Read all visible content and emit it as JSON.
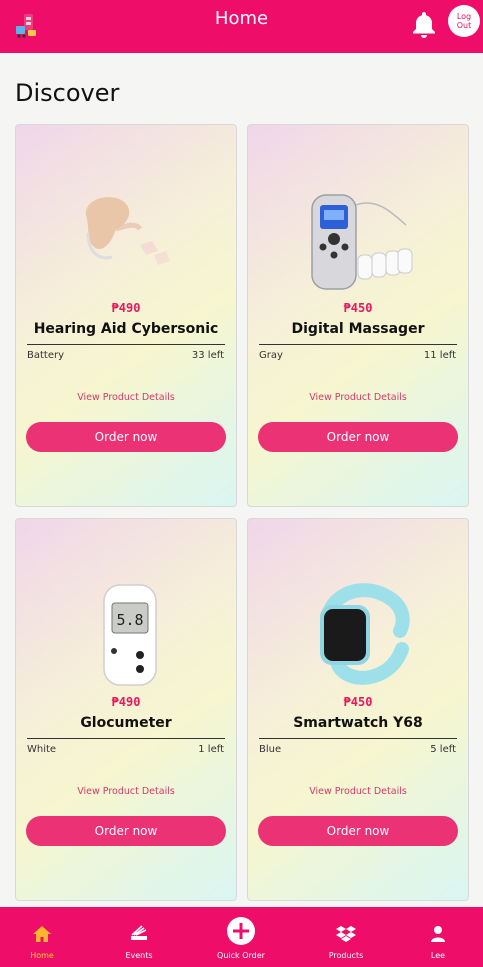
{
  "header": {
    "title": "Home",
    "logout_label": "Log Out"
  },
  "main": {
    "heading": "Discover",
    "currency_symbol": "₱"
  },
  "products": [
    {
      "price": "₱490",
      "name": "Hearing Aid Cybersonic",
      "variant": "Battery",
      "stock": "33 left",
      "details_label": "View Product Details",
      "order_label": "Order now",
      "image": "hearing-aid-image"
    },
    {
      "price": "₱450",
      "name": "Digital Massager",
      "variant": "Gray",
      "stock": "11 left",
      "details_label": "View Product Details",
      "order_label": "Order now",
      "image": "digital-massager-image"
    },
    {
      "price": "₱490",
      "name": "Glocumeter",
      "variant": "White",
      "stock": "1 left",
      "details_label": "View Product Details",
      "order_label": "Order now",
      "image": "glucometer-image"
    },
    {
      "price": "₱450",
      "name": "Smartwatch Y68",
      "variant": "Blue",
      "stock": "5 left",
      "details_label": "View Product Details",
      "order_label": "Order now",
      "image": "smartwatch-image"
    }
  ],
  "nav": {
    "items": [
      {
        "label": "Home",
        "icon": "home-icon",
        "active": true
      },
      {
        "label": "Events",
        "icon": "events-icon",
        "active": false
      },
      {
        "label": "Quick Order",
        "icon": "plus-circle-icon",
        "active": false
      },
      {
        "label": "Products",
        "icon": "dropbox-icon",
        "active": false
      },
      {
        "label": "Lee",
        "icon": "user-icon",
        "active": false
      }
    ]
  },
  "colors": {
    "brand": "#ee0d69",
    "button": "#ea3274",
    "price": "#e7175f",
    "active_nav": "#ffd22a"
  }
}
